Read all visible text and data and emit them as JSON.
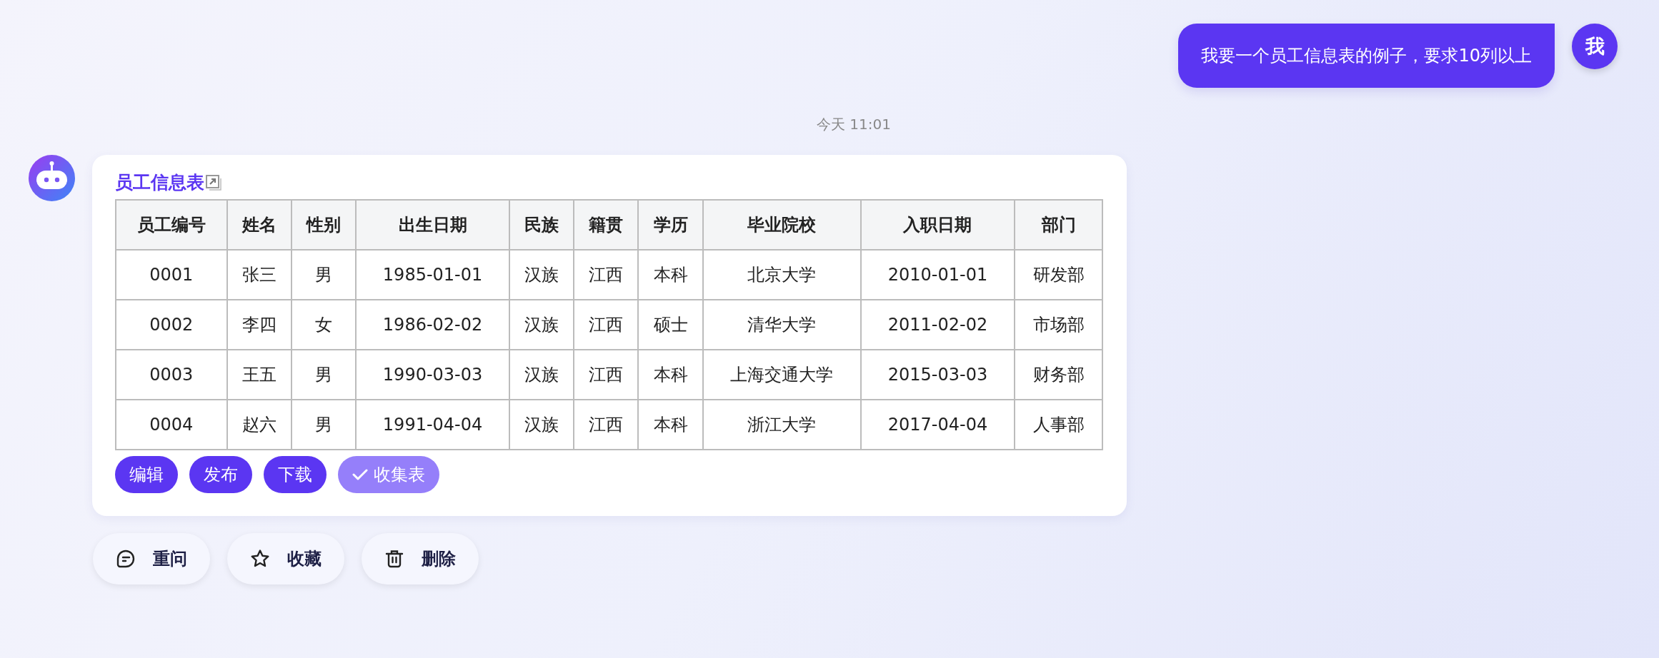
{
  "user_message": {
    "text": "我要一个员工信息表的例子，要求10列以上",
    "avatar": "我"
  },
  "timestamp": "今天 11:01",
  "bot_message": {
    "title": "员工信息表",
    "table": {
      "columns": [
        "员工编号",
        "姓名",
        "性别",
        "出生日期",
        "民族",
        "籍贯",
        "学历",
        "毕业院校",
        "入职日期",
        "部门"
      ],
      "rows": [
        [
          "0001",
          "张三",
          "男",
          "1985-01-01",
          "汉族",
          "江西",
          "本科",
          "北京大学",
          "2010-01-01",
          "研发部"
        ],
        [
          "0002",
          "李四",
          "女",
          "1986-02-02",
          "汉族",
          "江西",
          "硕士",
          "清华大学",
          "2011-02-02",
          "市场部"
        ],
        [
          "0003",
          "王五",
          "男",
          "1990-03-03",
          "汉族",
          "江西",
          "本科",
          "上海交通大学",
          "2015-03-03",
          "财务部"
        ],
        [
          "0004",
          "赵六",
          "男",
          "1991-04-04",
          "汉族",
          "江西",
          "本科",
          "浙江大学",
          "2017-04-04",
          "人事部"
        ]
      ]
    },
    "actions": [
      {
        "label": "编辑",
        "checked": false
      },
      {
        "label": "发布",
        "checked": false
      },
      {
        "label": "下载",
        "checked": false
      },
      {
        "label": "收集表",
        "checked": true
      }
    ]
  },
  "footer_buttons": [
    {
      "label": "重问",
      "kind": "reask"
    },
    {
      "label": "收藏",
      "kind": "favorite"
    },
    {
      "label": "删除",
      "kind": "delete"
    }
  ]
}
